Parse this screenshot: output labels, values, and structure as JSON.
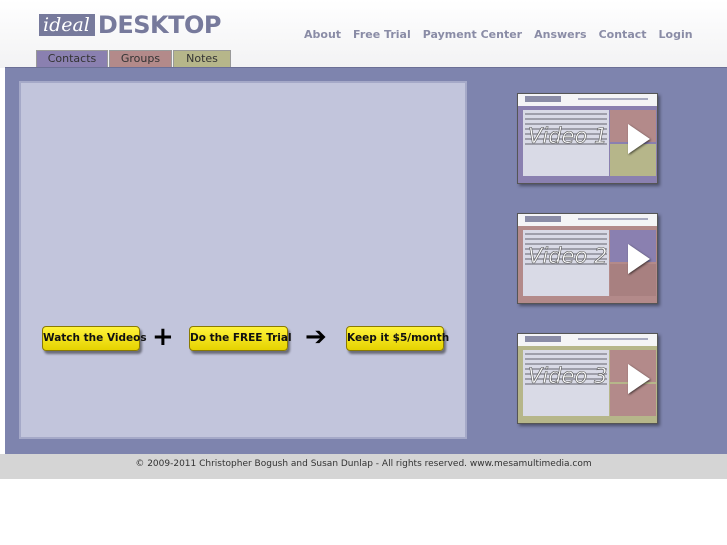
{
  "logo": {
    "ideal": "ideal",
    "desktop": "DESKTOP"
  },
  "nav": [
    "About",
    "Free Trial",
    "Payment Center",
    "Answers",
    "Contact",
    "Login"
  ],
  "tabs": [
    "Contacts",
    "Groups",
    "Notes"
  ],
  "cta": {
    "videos": "Watch the Videos",
    "plus": "+",
    "trial": "Do the FREE Trial",
    "arrow": "➔",
    "keep": "Keep it $5/month"
  },
  "videos": [
    "Video 1",
    "Video 2",
    "Video 3"
  ],
  "footer": "© 2009-2011 Christopher Bogush and Susan Dunlap - All rights reserved. www.mesamultimedia.com",
  "colors": {
    "brand": "#777a9c",
    "panel": "#7e84ae",
    "contacts_tab": "#8a80b0",
    "groups_tab": "#b38a8a",
    "notes_tab": "#b6b68a",
    "cta_yellow": "#fff33a"
  }
}
